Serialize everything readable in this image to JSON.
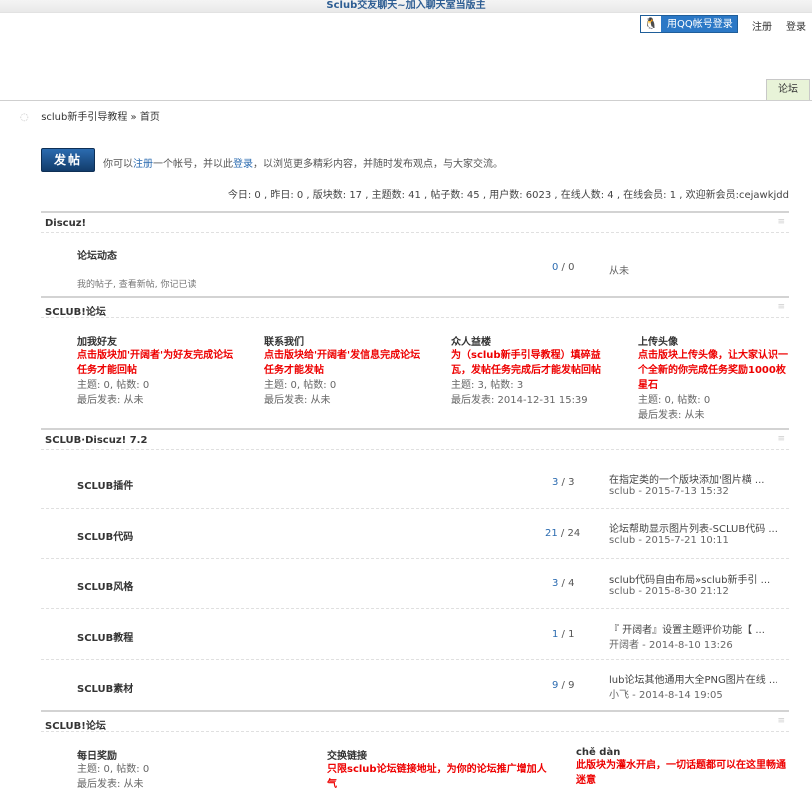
{
  "topbar": {
    "title": "Sclub交友聊天~加入聊天室当版主"
  },
  "header": {
    "qq_icon": "qq-penguin-icon",
    "qq_login": "用QQ帐号登录",
    "register": "注册",
    "login": "登录",
    "forum_tab": "论坛"
  },
  "breadcrumb": {
    "home_icon": "home-icon",
    "site": "sclub新手引导教程",
    "sep": "»",
    "current": "首页"
  },
  "post_button": "发帖",
  "intro": {
    "pre": "你可以",
    "register_link": "注册",
    "mid1": "一个帐号，并以此",
    "login_link": "登录",
    "post": "，以浏览更多精彩内容，并随时发布观点，与大家交流。"
  },
  "stats": "今日: 0 , 昨日: 0 , 版块数: 17 , 主题数: 41 , 帖子数: 45 , 用户数: 6023 , 在线人数: 4 , 在线会员: 1 , 欢迎新会员:cejawkjdd",
  "categories": [
    {
      "name": "Discuz!",
      "forums": [
        {
          "name": "论坛动态",
          "desc": "我的帖子, 查看新帖, 你记已读",
          "topics": "0",
          "posts": "0",
          "last": "从未"
        }
      ]
    },
    {
      "name": "SCLUB!论坛",
      "columns": [
        {
          "name": "加我好友",
          "desc": "点击版块加'开阔者'为好友完成论坛任务才能回帖",
          "stat": "主题: 0, 帖数: 0",
          "last": "最后发表: 从未"
        },
        {
          "name": "联系我们",
          "desc": "点击版块给'开阔者'发信息完成论坛任务才能发帖",
          "stat": "主题: 0, 帖数: 0",
          "last": "最后发表: 从未"
        },
        {
          "name": "众人益楼",
          "desc": "为（sclub新手引导教程）填碎益瓦，发帖任务完成后才能发帖回帖",
          "stat": "主题: 3, 帖数: 3",
          "last": "最后发表: 2014-12-31 15:39"
        },
        {
          "name": "上传头像",
          "desc": "点击版块上传头像，让大家认识一个全新的你完成任务奖励1000枚星石",
          "stat": "主题: 0, 帖数: 0",
          "last": "最后发表: 从未"
        }
      ]
    },
    {
      "name": "SCLUB·Discuz! 7.2",
      "forums": [
        {
          "name": "SCLUB插件",
          "topics": "3",
          "posts": "3",
          "last_title": "在指定类的一个版块添加'图片横 ...",
          "last_meta": "sclub - 2015-7-13 15:32"
        },
        {
          "name": "SCLUB代码",
          "topics": "21",
          "posts": "24",
          "last_title": "论坛帮助显示图片列表-SCLUB代码 ...",
          "last_meta": "sclub - 2015-7-21 10:11"
        },
        {
          "name": "SCLUB风格",
          "topics": "3",
          "posts": "4",
          "last_title": "sclub代码自由布局»sclub新手引 ...",
          "last_meta": "sclub - 2015-8-30 21:12"
        },
        {
          "name": "SCLUB教程",
          "topics": "1",
          "posts": "1",
          "last_title": "『 开阔者』设置主题评价功能【 ...",
          "last_meta": "开阔者 - 2014-8-10 13:26"
        },
        {
          "name": "SCLUB素材",
          "topics": "9",
          "posts": "9",
          "last_title": "lub论坛其他通用大全PNG图片在线 ...",
          "last_meta": "小飞 - 2014-8-14 19:05"
        }
      ]
    },
    {
      "name": "SCLUB!论坛",
      "columns": [
        {
          "name": "每日奖励",
          "desc": "",
          "stat": "主题: 0, 帖数: 0",
          "last": "最后发表: 从未"
        },
        {
          "name": "交换链接",
          "desc": "只限sclub论坛链接地址，为你的论坛推广增加人气",
          "stat": "",
          "last": ""
        },
        {
          "name": "chě dàn",
          "desc": "此版块为灌水开启，一切话题都可以在这里畅通迷意",
          "stat": "",
          "last": ""
        }
      ]
    }
  ],
  "collapse_icon": "collapse-icon"
}
